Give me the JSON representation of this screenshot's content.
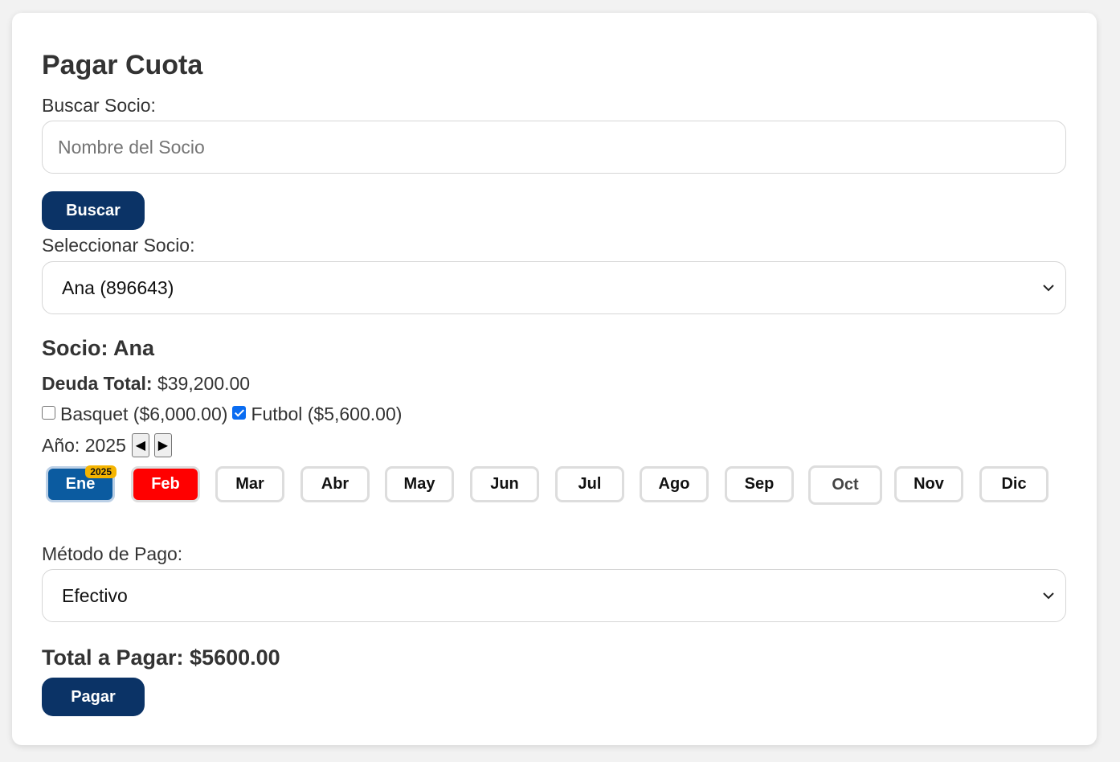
{
  "title": "Pagar Cuota",
  "search": {
    "label": "Buscar Socio:",
    "placeholder": "Nombre del Socio",
    "button": "Buscar"
  },
  "select_member": {
    "label": "Seleccionar Socio:",
    "value": "Ana (896643)"
  },
  "member": {
    "heading": "Socio: Ana",
    "debt_label": "Deuda Total:",
    "debt_value": "$39,200.00",
    "sports": [
      {
        "label": "Basquet ($6,000.00)",
        "checked": false
      },
      {
        "label": "Futbol ($5,600.00)",
        "checked": true
      }
    ]
  },
  "year": {
    "label": "Año: 2025",
    "prev_icon": "triangle-left-icon",
    "next_icon": "triangle-right-icon"
  },
  "months": [
    {
      "label": "Ene",
      "state": "paid",
      "badge": "2025"
    },
    {
      "label": "Feb",
      "state": "due"
    },
    {
      "label": "Mar",
      "state": "normal"
    },
    {
      "label": "Abr",
      "state": "normal"
    },
    {
      "label": "May",
      "state": "normal"
    },
    {
      "label": "Jun",
      "state": "normal"
    },
    {
      "label": "Jul",
      "state": "normal"
    },
    {
      "label": "Ago",
      "state": "normal"
    },
    {
      "label": "Sep",
      "state": "normal"
    },
    {
      "label": "Oct",
      "state": "disabled"
    },
    {
      "label": "Nov",
      "state": "normal"
    },
    {
      "label": "Dic",
      "state": "normal"
    }
  ],
  "payment": {
    "label": "Método de Pago:",
    "value": "Efectivo"
  },
  "total": "Total a Pagar: $5600.00",
  "pay_button": "Pagar",
  "colors": {
    "primary": "#0b3366",
    "paid_month": "#0b5ba0",
    "due_month": "#ff0000",
    "badge": "#f5b400",
    "checkbox": "#0a6cf1"
  }
}
